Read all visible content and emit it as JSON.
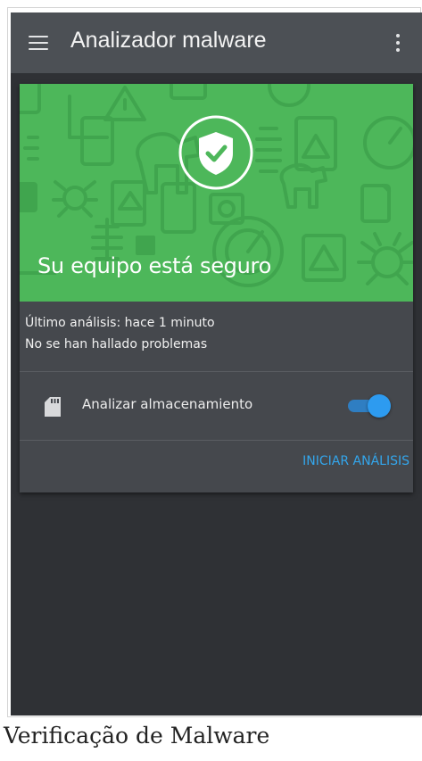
{
  "app_bar": {
    "title": "Analizador malware",
    "background": "#4c5055",
    "menu_icon": "hamburger-menu-icon",
    "overflow_icon": "more-vertical-icon"
  },
  "card": {
    "hero": {
      "background": "#4db75a",
      "icon": "shield-check-icon",
      "headline": "Su equipo está seguro"
    },
    "status": {
      "last_scan": "Último análisis: hace 1 minuto",
      "result": "No se han hallado problemas"
    },
    "storage_option": {
      "icon": "sd-card-icon",
      "label": "Analizar almacenamiento",
      "enabled": true
    },
    "action": {
      "label": "INICIAR ANÁLISIS",
      "color": "#33a6ec"
    }
  },
  "caption": "Verificação de Malware"
}
